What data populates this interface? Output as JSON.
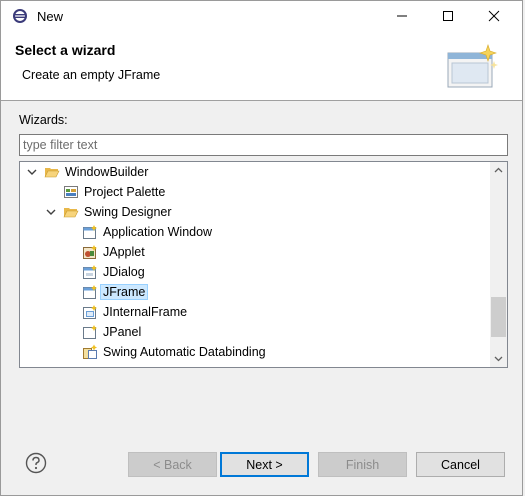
{
  "window": {
    "title": "New"
  },
  "banner": {
    "title": "Select a wizard",
    "subtitle": "Create an empty JFrame"
  },
  "wizards": {
    "label": "Wizards:",
    "filter_placeholder": "type filter text",
    "filter_value": ""
  },
  "tree": {
    "items": [
      {
        "label": "WindowBuilder",
        "icon": "folder-open-icon",
        "expanded": true,
        "level": 0
      },
      {
        "label": "Project Palette",
        "icon": "palette-icon",
        "level": 1
      },
      {
        "label": "Swing Designer",
        "icon": "folder-open-icon",
        "expanded": true,
        "level": 1
      },
      {
        "label": "Application Window",
        "icon": "window-class-icon",
        "level": 2
      },
      {
        "label": "JApplet",
        "icon": "applet-icon",
        "level": 2
      },
      {
        "label": "JDialog",
        "icon": "dialog-class-icon",
        "level": 2
      },
      {
        "label": "JFrame",
        "icon": "frame-class-icon",
        "level": 2,
        "selected": true
      },
      {
        "label": "JInternalFrame",
        "icon": "internal-frame-icon",
        "level": 2
      },
      {
        "label": "JPanel",
        "icon": "panel-class-icon",
        "level": 2
      },
      {
        "label": "Swing Automatic Databinding",
        "icon": "databinding-icon",
        "level": 2
      }
    ]
  },
  "buttons": {
    "back": "< Back",
    "next": "Next >",
    "finish": "Finish",
    "cancel": "Cancel"
  },
  "colors": {
    "selection": "#cce8ff",
    "default_button_border": "#0078d7",
    "folder": "#e8b84a"
  }
}
